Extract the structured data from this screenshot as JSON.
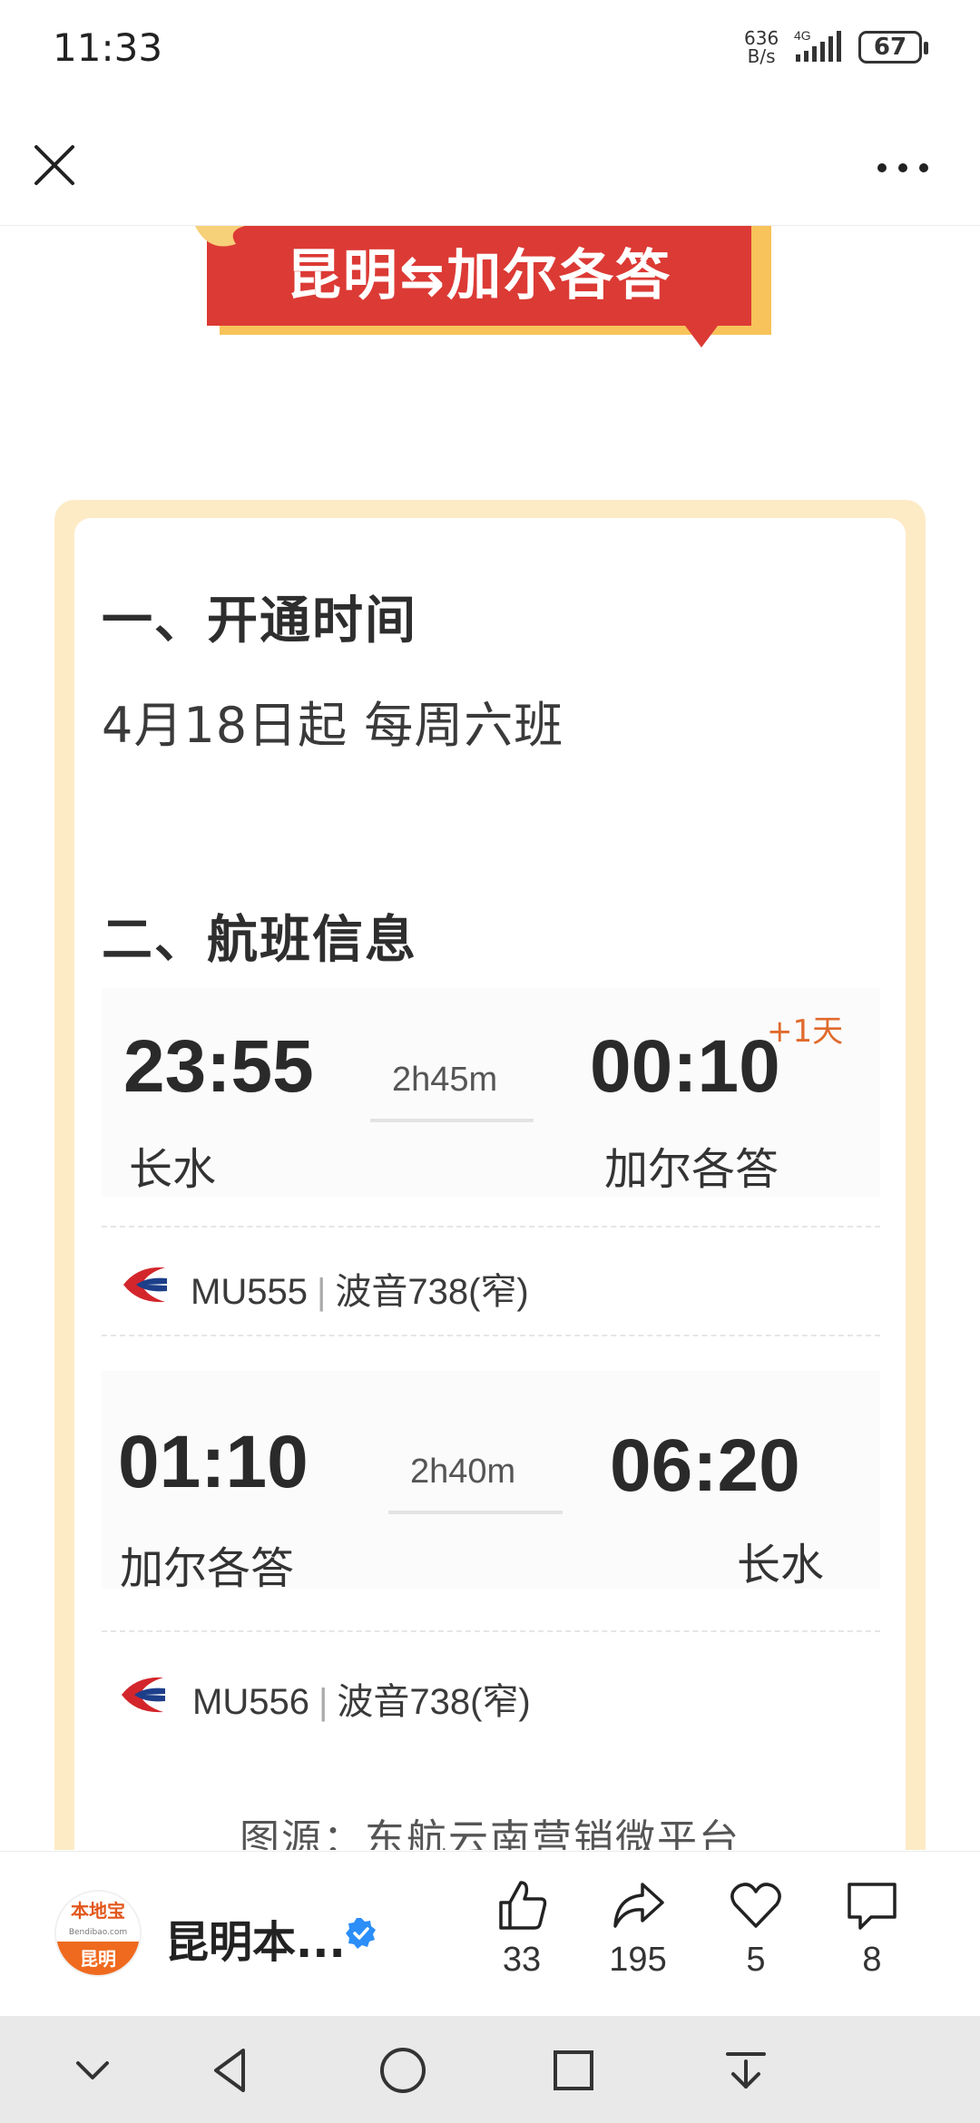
{
  "status_bar": {
    "time": "11:33",
    "net_speed_value": "636",
    "net_speed_unit": "B/s",
    "network": "4G",
    "battery": "67"
  },
  "toolbar": {
    "close_icon": "close-icon",
    "more_icon": "more-icon"
  },
  "banner": {
    "text": "昆明⇆加尔各答"
  },
  "section1": {
    "title": "一、开通时间",
    "text": "4月18日起 每周六班"
  },
  "section2": {
    "title": "二、航班信息",
    "flights": [
      {
        "dep_time": "23:55",
        "dep_city": "长水",
        "duration": "2h45m",
        "arr_time": "00:10",
        "arr_city": "加尔各答",
        "day_offset": "+1天",
        "flight_no": "MU555",
        "aircraft": "波音738(窄)"
      },
      {
        "dep_time": "01:10",
        "dep_city": "加尔各答",
        "duration": "2h40m",
        "arr_time": "06:20",
        "arr_city": "长水",
        "day_offset": "",
        "flight_no": "MU556",
        "aircraft": "波音738(窄)"
      }
    ]
  },
  "caption": "图源：东航云南营销微平台",
  "footer": {
    "avatar_top": "本地宝",
    "avatar_mid": "Bendibao.com",
    "avatar_bottom": "昆明",
    "account_name": "昆明本...",
    "likes": "33",
    "shares": "195",
    "favorites": "5",
    "comments": "8"
  },
  "colors": {
    "banner_red": "#dc3a35",
    "card_border": "#fdebc6",
    "accent_orange": "#e06a2c"
  }
}
